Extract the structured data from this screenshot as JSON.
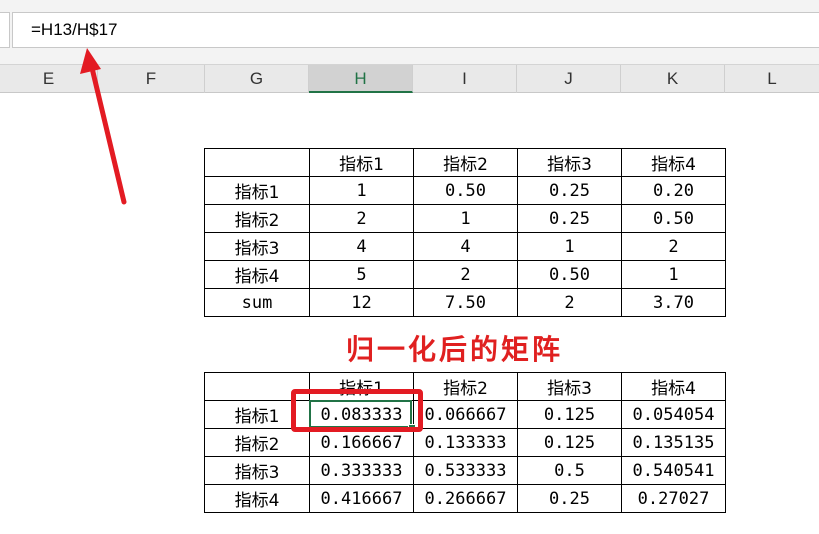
{
  "formula_bar": {
    "formula": "=H13/H$17"
  },
  "column_headers": [
    "E",
    "F",
    "G",
    "H",
    "I",
    "J",
    "K",
    "L"
  ],
  "selected_column": "H",
  "table1": {
    "header": [
      "",
      "指标1",
      "指标2",
      "指标3",
      "指标4"
    ],
    "rows": [
      [
        "指标1",
        "1",
        "0.50",
        "0.25",
        "0.20"
      ],
      [
        "指标2",
        "2",
        "1",
        "0.25",
        "0.50"
      ],
      [
        "指标3",
        "4",
        "4",
        "1",
        "2"
      ],
      [
        "指标4",
        "5",
        "2",
        "0.50",
        "1"
      ],
      [
        "sum",
        "12",
        "7.50",
        "2",
        "3.70"
      ]
    ]
  },
  "heading": "归一化后的矩阵",
  "table2": {
    "header": [
      "",
      "指标1",
      "指标2",
      "指标3",
      "指标4"
    ],
    "rows": [
      [
        "指标1",
        "0.083333",
        "0.066667",
        "0.125",
        "0.054054"
      ],
      [
        "指标2",
        "0.166667",
        "0.133333",
        "0.125",
        "0.135135"
      ],
      [
        "指标3",
        "0.333333",
        "0.533333",
        "0.5",
        "0.540541"
      ],
      [
        "指标4",
        "0.416667",
        "0.266667",
        "0.25",
        "0.27027"
      ]
    ]
  },
  "colors": {
    "accent": "#217346",
    "annotation": "#e31b23"
  }
}
